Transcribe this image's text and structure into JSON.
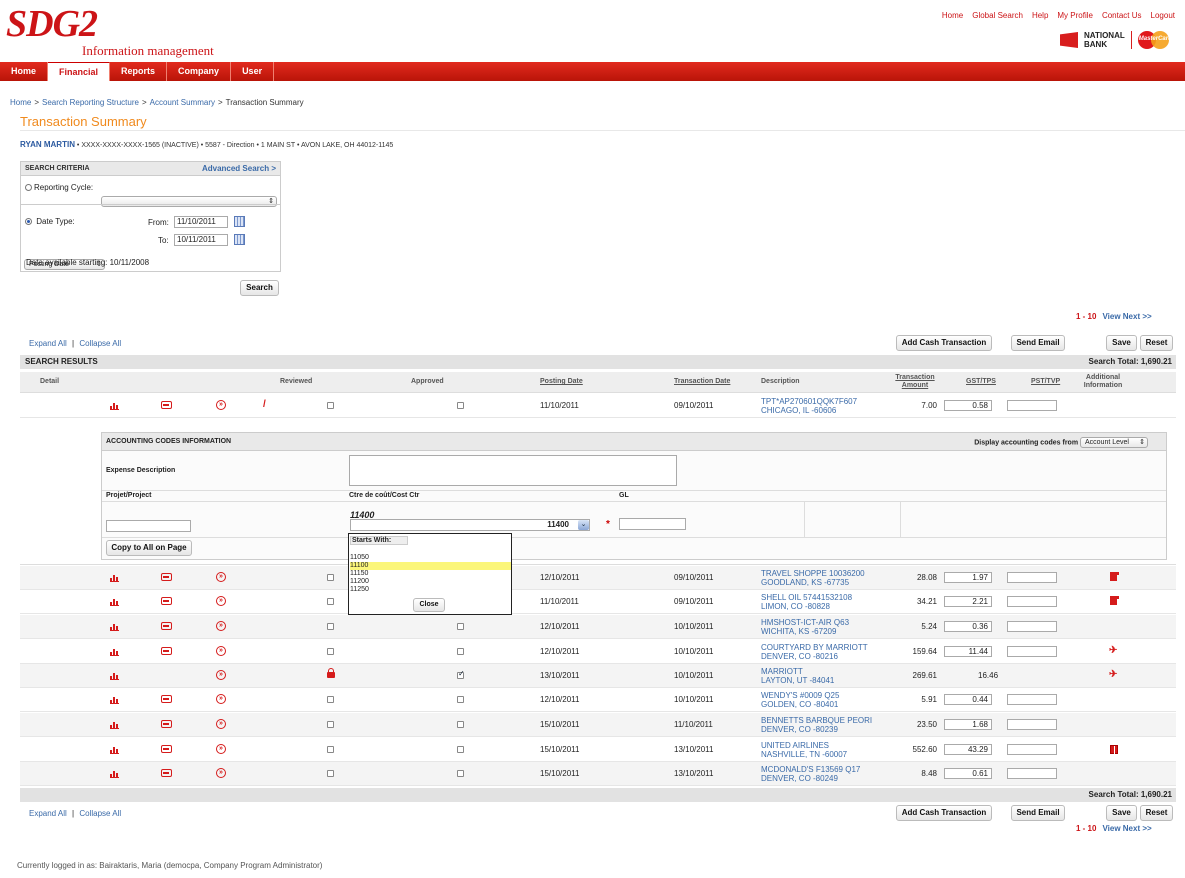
{
  "brand": {
    "logo": "SDG2",
    "subtitle": "Information management",
    "bank_name_line1": "NATIONAL",
    "bank_name_line2": "BANK",
    "card": "MasterCard"
  },
  "top_links": [
    "Home",
    "Global Search",
    "Help",
    "My Profile",
    "Contact Us",
    "Logout"
  ],
  "nav": {
    "items": [
      "Home",
      "Financial",
      "Reports",
      "Company",
      "User"
    ],
    "active": "Financial"
  },
  "breadcrumb": [
    "Home",
    "Search Reporting Structure",
    "Account Summary",
    "Transaction Summary"
  ],
  "breadcrumb_sep": ">",
  "page_title": "Transaction Summary",
  "account": {
    "name": "RYAN MARTIN",
    "details": "• XXXX-XXXX-XXXX-1565 (INACTIVE) • 5587 - Direction • 1 MAIN ST • AVON LAKE, OH 44012-1145"
  },
  "search_criteria": {
    "title": "SEARCH CRITERIA",
    "advanced": "Advanced Search >",
    "reporting_cycle_label": "Reporting Cycle:",
    "reporting_cycle_value": "",
    "date_type_label": "Date Type:",
    "date_type_value": "Posting Date",
    "from_label": "From:",
    "from_value": "11/10/2011",
    "to_label": "To:",
    "to_value": "10/11/2011",
    "data_available": "Data available starting: 10/11/2008",
    "search_button": "Search"
  },
  "pagination": {
    "range": "1 - 10",
    "next": "View Next >>"
  },
  "actions": {
    "expand_all": "Expand All",
    "collapse_all": "Collapse All",
    "sep": "|",
    "add_cash": "Add Cash Transaction",
    "send_email": "Send Email",
    "save": "Save",
    "reset": "Reset"
  },
  "results": {
    "title": "SEARCH RESULTS",
    "total": "Search Total: 1,690.21"
  },
  "columns": {
    "detail": "Detail",
    "reviewed": "Reviewed",
    "approved": "Approved",
    "posting_date": "Posting Date",
    "transaction_date": "Transaction Date",
    "description": "Description",
    "amount_1": "Transaction",
    "amount_2": "Amount",
    "gst": "GST/TPS",
    "pst": "PST/TVP",
    "add_1": "Additional",
    "add_2": "Information"
  },
  "accounting": {
    "title": "ACCOUNTING CODES INFORMATION",
    "display_label": "Display accounting codes from",
    "display_value": "Account Level",
    "expense_label": "Expense Description",
    "project_label": "Projet/Project",
    "costctr_label": "Ctre de coût/Cost Ctr",
    "gl_label": "GL",
    "costctr_current": "11400",
    "costctr_select": "11400",
    "required": "*",
    "copy_button": "Copy to All on Page"
  },
  "dropdown": {
    "starts_with": "Starts With:",
    "options": [
      "11050",
      "11100",
      "11150",
      "11200",
      "11250"
    ],
    "highlighted": "11100",
    "close": "Close"
  },
  "rows": [
    {
      "posting": "11/10/2011",
      "trans": "09/10/2011",
      "desc1": "TPT*AP270601QQK7F607",
      "desc2": "CHICAGO, IL -60606",
      "amount": "7.00",
      "gst": "0.58",
      "reviewed": false,
      "approved": false,
      "add": ""
    },
    {
      "posting": "12/10/2011",
      "trans": "09/10/2011",
      "desc1": "TRAVEL SHOPPE 10036200",
      "desc2": "GOODLAND, KS -67735",
      "amount": "28.08",
      "gst": "1.97",
      "reviewed": false,
      "approved": false,
      "add": "doc"
    },
    {
      "posting": "11/10/2011",
      "trans": "09/10/2011",
      "desc1": "SHELL OIL 57441532108",
      "desc2": "LIMON, CO -80828",
      "amount": "34.21",
      "gst": "2.21",
      "reviewed": false,
      "approved": false,
      "add": "doc"
    },
    {
      "posting": "12/10/2011",
      "trans": "10/10/2011",
      "desc1": "HMSHOST-ICT-AIR Q63",
      "desc2": "WICHITA, KS -67209",
      "amount": "5.24",
      "gst": "0.36",
      "reviewed": false,
      "approved": false,
      "add": ""
    },
    {
      "posting": "12/10/2011",
      "trans": "10/10/2011",
      "desc1": "COURTYARD BY MARRIOTT",
      "desc2": "DENVER, CO -80216",
      "amount": "159.64",
      "gst": "11.44",
      "reviewed": false,
      "approved": false,
      "add": "plane"
    },
    {
      "posting": "13/10/2011",
      "trans": "10/10/2011",
      "desc1": "MARRIOTT",
      "desc2": "LAYTON, UT -84041",
      "amount": "269.61",
      "gst": "16.46",
      "reviewed": false,
      "approved": true,
      "add": "plane",
      "locked": true
    },
    {
      "posting": "12/10/2011",
      "trans": "10/10/2011",
      "desc1": "WENDY'S #0009 Q25",
      "desc2": "GOLDEN, CO -80401",
      "amount": "5.91",
      "gst": "0.44",
      "reviewed": false,
      "approved": false,
      "add": ""
    },
    {
      "posting": "15/10/2011",
      "trans": "11/10/2011",
      "desc1": "BENNETTS BARBQUE PEORI",
      "desc2": "DENVER, CO -80239",
      "amount": "23.50",
      "gst": "1.68",
      "reviewed": false,
      "approved": false,
      "add": ""
    },
    {
      "posting": "15/10/2011",
      "trans": "13/10/2011",
      "desc1": "UNITED AIRLINES",
      "desc2": "NASHVILLE, TN -60007",
      "amount": "552.60",
      "gst": "43.29",
      "reviewed": false,
      "approved": false,
      "add": "gift"
    },
    {
      "posting": "15/10/2011",
      "trans": "13/10/2011",
      "desc1": "MCDONALD'S F13569 Q17",
      "desc2": "DENVER, CO -80249",
      "amount": "8.48",
      "gst": "0.61",
      "reviewed": false,
      "approved": false,
      "add": ""
    }
  ],
  "icons": {
    "chart": "bar-chart-icon",
    "car": "car-icon",
    "go": "forward-icon",
    "edit": "pencil-icon",
    "lock": "lock-icon",
    "doc": "receipt-icon",
    "plane": "travel-icon",
    "gift": "gift-icon",
    "calendar": "calendar-icon"
  },
  "footer": "Currently logged in as: Bairaktaris, Maria (democpa, Company Program Administrator)"
}
